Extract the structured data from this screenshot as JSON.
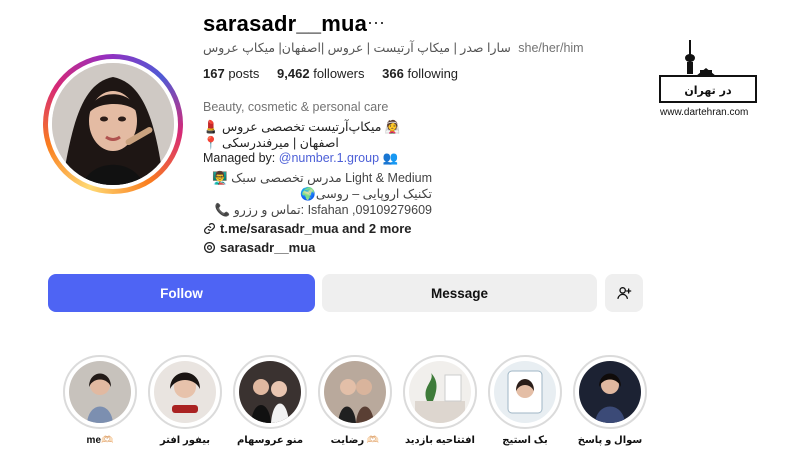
{
  "profile": {
    "username": "sarasadr__mua",
    "more_label": "···",
    "name_line": "سارا صدر | میکاپ آرتیست | عروس |اصفهان| میکاپ عروس",
    "pronouns": "she/her/him",
    "stats": {
      "posts_count": "167",
      "posts_label": "posts",
      "followers_count": "9,462",
      "followers_label": "followers",
      "following_count": "366",
      "following_label": "following"
    },
    "category": "Beauty, cosmetic & personal care",
    "bio_lines": [
      "💄 میکاپ‌آرتیست تخصصی عروس 👰",
      "📍 اصفهان | میرفندرسکی"
    ],
    "managed_prefix": "Managed by:",
    "managed_handle": "@number.1.group",
    "managed_emoji": "👥",
    "rtl_lines": [
      "👨‍🏫 مدرس تخصصی سبک Light & Medium",
      "🌍تکنیک اروپایی – روسی",
      "📞 تماس و رزرو: Isfahan ,09109279609"
    ],
    "link_text": "t.me/sarasadr_mua and 2 more",
    "threads_handle": "sarasadr__mua"
  },
  "actions": {
    "follow_label": "Follow",
    "message_label": "Message",
    "add_icon": "person-add-icon"
  },
  "highlights": [
    {
      "label": "me🫶🏻"
    },
    {
      "label": "بیفور افتر"
    },
    {
      "label": "منو عروسهام"
    },
    {
      "label": "رضایت 🫶🏻"
    },
    {
      "label": "افتتاحیه بازدید"
    },
    {
      "label": "بک استیج"
    },
    {
      "label": "سوال و پاسخ"
    }
  ],
  "watermark": {
    "logo_text": "در تهران",
    "site": "www.dartehran.com"
  },
  "colors": {
    "accent": "#4e64f4",
    "link": "#4c5fd7",
    "button_bg": "#efefef"
  }
}
